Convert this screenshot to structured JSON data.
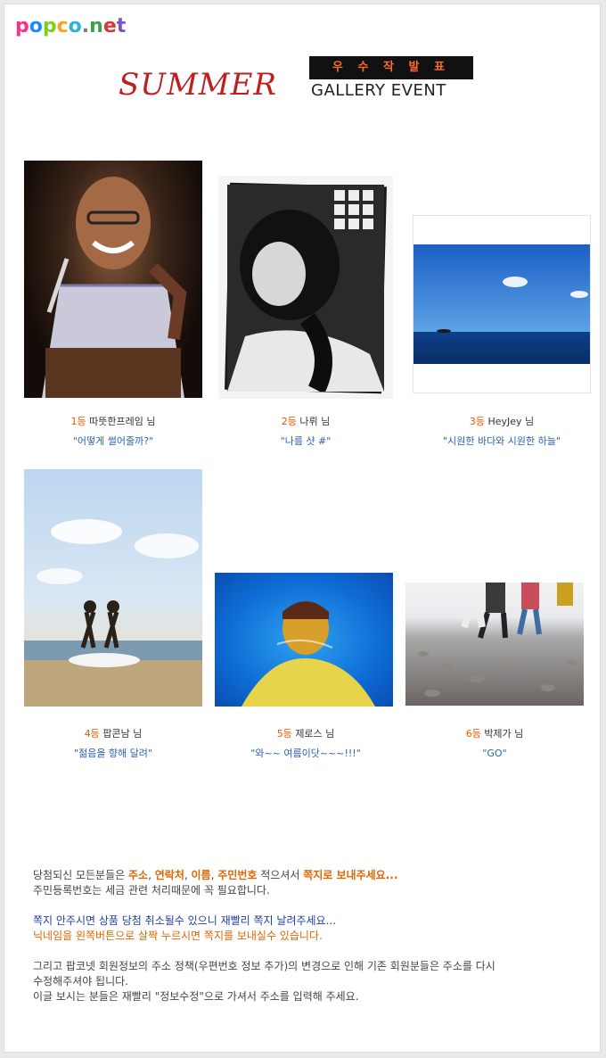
{
  "logo": {
    "letters": [
      "p",
      "o",
      "p",
      "c",
      "o",
      ".",
      "n",
      "e",
      "t"
    ],
    "colors": [
      "#ff2e8a",
      "#1e88ff",
      "#7ccf1f",
      "#ff9f1a",
      "#2bb3d9",
      "#7c7c7c",
      "#3fa14f",
      "#d53b3b",
      "#7a54c6"
    ]
  },
  "banner": {
    "summer": "SUMMER",
    "gallery": "GALLERY EVENT",
    "winner": "우 수 작  발 표"
  },
  "winners": [
    {
      "rank": "1등",
      "name": "따뜻한프레임 님",
      "quote": "\"어떻게 썰어줄까?\""
    },
    {
      "rank": "2등",
      "name": "나뤼 님",
      "quote": "\"나름 샷 #\""
    },
    {
      "rank": "3등",
      "name": "HeyJey 님",
      "quote": "\"시원한 바다와 시원한 하늘\""
    },
    {
      "rank": "4등",
      "name": "팝콘남 님",
      "quote": "\"젊음을 향해 달려\""
    },
    {
      "rank": "5등",
      "name": "제로스 님",
      "quote": "\"와~~ 여름이닷~~~!!!\""
    },
    {
      "rank": "6등",
      "name": "박제가 님",
      "quote": "\"GO\""
    }
  ],
  "notice": {
    "l1_a": "당첨되신 모든분들은 ",
    "l1_b": "주소",
    "l1_c": ", ",
    "l1_d": "연락처",
    "l1_e": ", ",
    "l1_f": "이름",
    "l1_g": ", ",
    "l1_h": "주민번호",
    "l1_i": " 적으셔서 ",
    "l1_j": "쪽지로 보내주세요...",
    "l2": "주민등록번호는 세금 관련 처리때문에 꼭 필요합니다.",
    "l3": "쪽지 안주시면 상품 당첨 취소될수 있으니 재빨리 쪽지 날려주세요...",
    "l4": "닉네임을 왼쪽버튼으로 살짝 누르시면 쪽지를 보내실수 있습니다.",
    "l5": "그리고 팝코넷 회원정보의 주소 정책(우편번호 정보 추가)의 변경으로 인해 기존 회원분들은 주소를 다시",
    "l6": "수정해주셔야 됩니다.",
    "l7": "이글 보시는 분들은 재빨리 \"정보수정\"으로 가셔서 주소를 입력해 주세요."
  }
}
